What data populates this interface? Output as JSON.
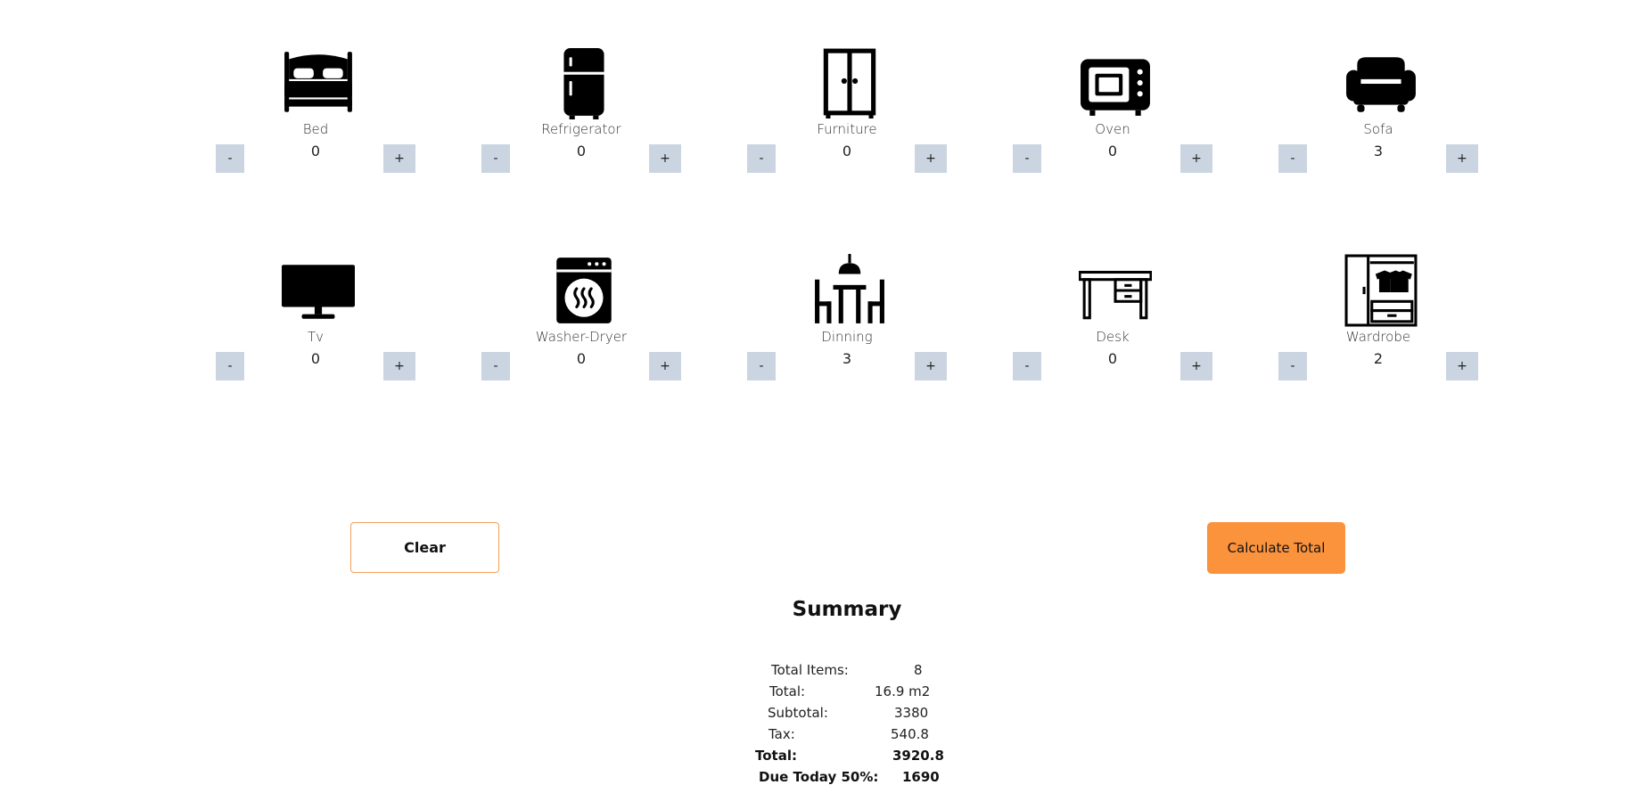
{
  "items": [
    {
      "name": "Bed",
      "count": "0",
      "icon": "bed-icon"
    },
    {
      "name": "Refrigerator",
      "count": "0",
      "icon": "refrigerator-icon"
    },
    {
      "name": "Furniture",
      "count": "0",
      "icon": "cabinet-icon"
    },
    {
      "name": "Oven",
      "count": "0",
      "icon": "oven-icon"
    },
    {
      "name": "Sofa",
      "count": "3",
      "icon": "sofa-icon"
    },
    {
      "name": "Tv",
      "count": "0",
      "icon": "tv-icon"
    },
    {
      "name": "Washer-Dryer",
      "count": "0",
      "icon": "washer-dryer-icon"
    },
    {
      "name": "Dinning",
      "count": "3",
      "icon": "dining-table-icon"
    },
    {
      "name": "Desk",
      "count": "0",
      "icon": "desk-icon"
    },
    {
      "name": "Wardrobe",
      "count": "2",
      "icon": "wardrobe-icon"
    }
  ],
  "controls": {
    "minus_label": "-",
    "plus_label": "+"
  },
  "actions": {
    "clear_label": "Clear",
    "calculate_label": "Calculate Total"
  },
  "colors": {
    "accent": "#fb923c",
    "stepper_bg": "#cbd5e1"
  },
  "summary": {
    "title": "Summary",
    "rows": [
      {
        "label": "Total Items:",
        "value": "8"
      },
      {
        "label": "Total:",
        "value": "16.9 m2"
      },
      {
        "label": "Subtotal:",
        "value": "3380"
      },
      {
        "label": "Tax:",
        "value": "540.8"
      },
      {
        "label": "Total:",
        "value": "3920.8"
      },
      {
        "label": "Due Today 50%:",
        "value": "1690"
      }
    ]
  }
}
